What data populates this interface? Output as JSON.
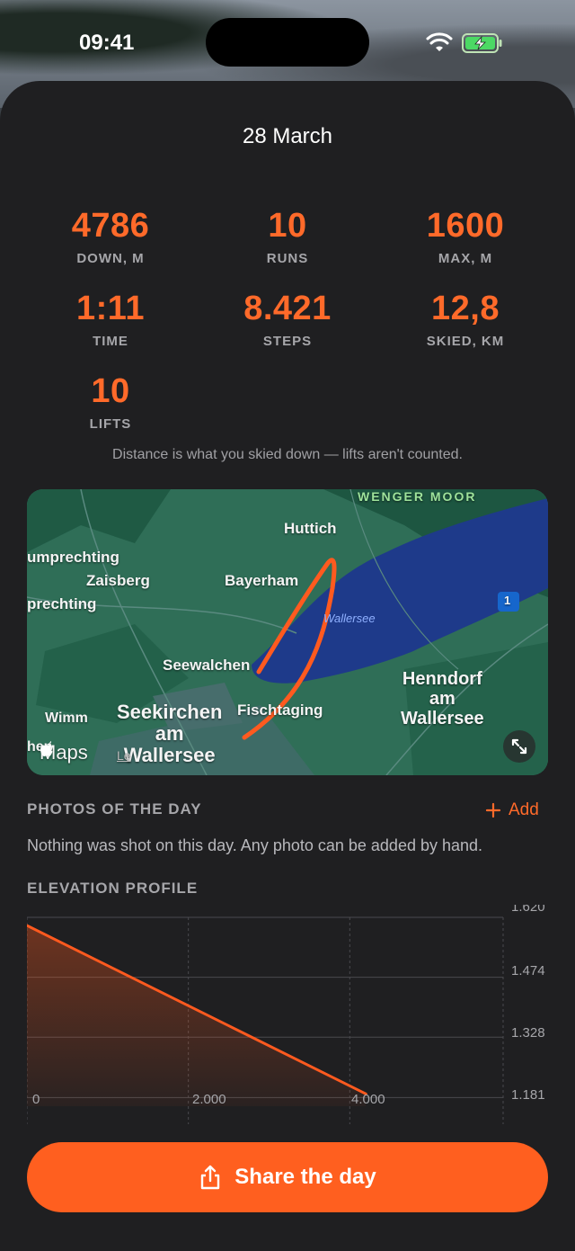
{
  "status_bar": {
    "time": "09:41"
  },
  "header": {
    "date": "28 March"
  },
  "stats": [
    {
      "value": "4786",
      "label": "DOWN, M"
    },
    {
      "value": "10",
      "label": "RUNS"
    },
    {
      "value": "1600",
      "label": "MAX, M"
    },
    {
      "value": "1:11",
      "label": "TIME"
    },
    {
      "value": "8.421",
      "label": "STEPS"
    },
    {
      "value": "12,8",
      "label": "SKIED, KM"
    },
    {
      "value": "10",
      "label": "LIFTS"
    }
  ],
  "distance_note": "Distance is what you skied down — lifts aren't counted.",
  "map": {
    "labels": {
      "wenger_moor": "WENGER MOOR",
      "huttich": "Huttich",
      "umprechting": "umprechting",
      "zaisberg": "Zaisberg",
      "bayerham": "Bayerham",
      "prechting": "prechting",
      "wallersee": "Wallersee",
      "seewalchen": "Seewalchen",
      "henndorf": "Henndorf\nam\nWallersee",
      "wimm": "Wimm",
      "seekirchen": "Seekirchen\nam\nWallersee",
      "fischtaging": "Fischtaging",
      "hen": "hen",
      "road_badge": "1",
      "maps_attribution": "Maps",
      "legal": "Le"
    },
    "route_color": "#ff5a1f",
    "water_color": "#1e3a8a"
  },
  "photos": {
    "title": "PHOTOS OF THE DAY",
    "add_label": "Add",
    "empty_text": "Nothing was shot on this day. Any photo can be added by hand."
  },
  "elevation": {
    "title": "ELEVATION PROFILE",
    "x_ticks": [
      "0",
      "2.000",
      "4.000"
    ],
    "y_ticks": [
      "1.620",
      "1.474",
      "1.328",
      "1.181"
    ]
  },
  "chart_data": {
    "type": "area",
    "title": "ELEVATION PROFILE",
    "x": [
      0,
      4200
    ],
    "y": [
      1600,
      1190
    ],
    "xlim": [
      0,
      5900
    ],
    "ylim": [
      1160,
      1620
    ],
    "x_ticks": [
      0,
      2000,
      4000
    ],
    "y_ticks": [
      1181,
      1328,
      1474,
      1620
    ],
    "grid": true,
    "color": "#ff5a1f"
  },
  "share": {
    "label": "Share the day"
  }
}
